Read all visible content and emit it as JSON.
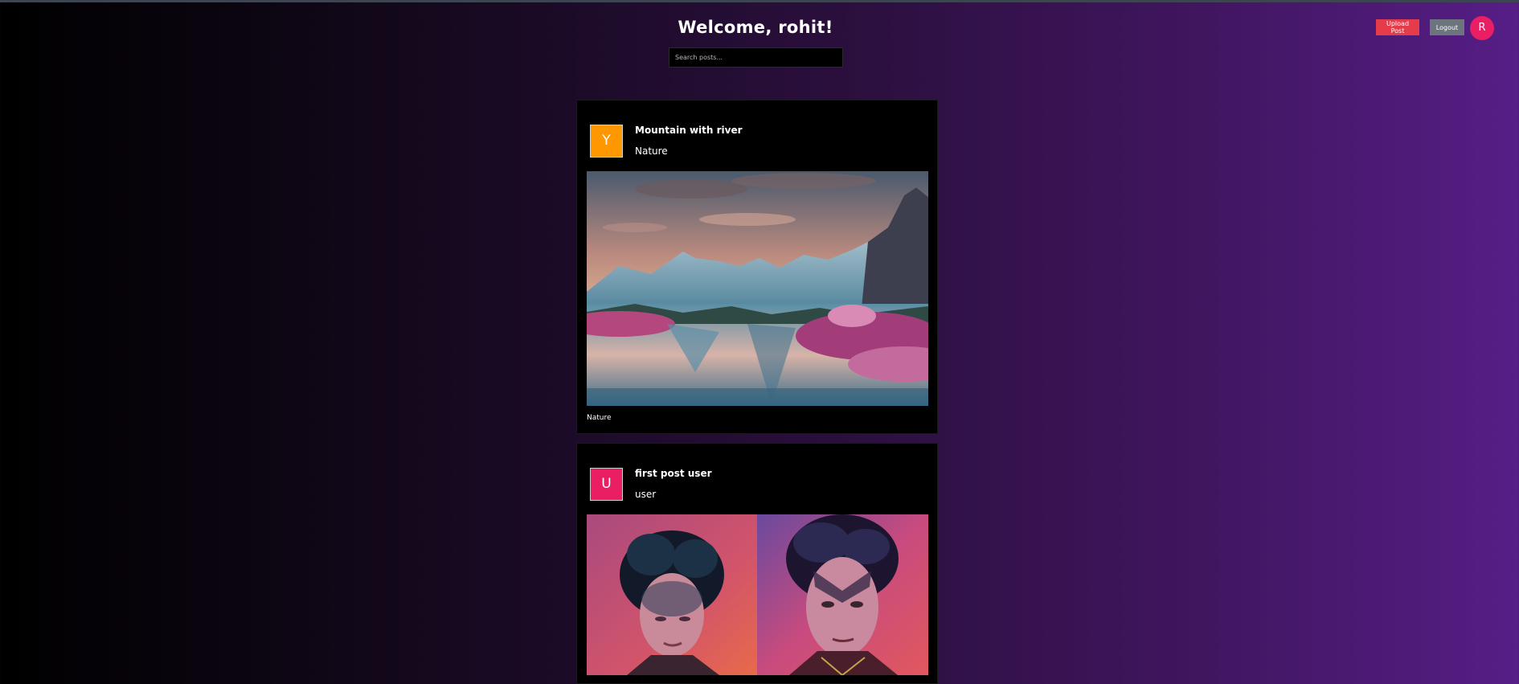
{
  "header": {
    "welcome": "Welcome, rohit!",
    "search_placeholder": "Search posts...",
    "upload_label": "Upload Post",
    "logout_label": "Logout",
    "avatar_initial": "R"
  },
  "colors": {
    "upload_button": "#e53b4a",
    "logout_button": "#6c757d",
    "user_avatar": "#e91e63",
    "post1_avatar": "#ff9800",
    "post2_avatar": "#e91e63"
  },
  "posts": [
    {
      "avatar_initial": "Y",
      "title": "Mountain with river",
      "category": "Nature",
      "caption": "Nature",
      "image": "mountain-lake-landscape"
    },
    {
      "avatar_initial": "U",
      "title": "first post user",
      "category": "user",
      "image": "two-portraits"
    }
  ]
}
